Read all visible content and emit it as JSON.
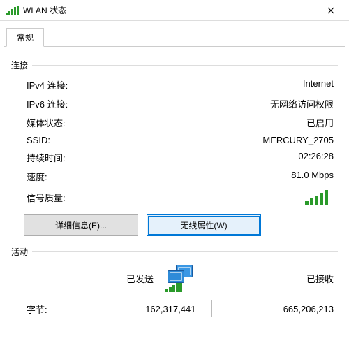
{
  "window": {
    "title": "WLAN 状态"
  },
  "tabs": {
    "general": "常规"
  },
  "connection": {
    "group_label": "连接",
    "ipv4_label": "IPv4 连接:",
    "ipv4_value": "Internet",
    "ipv6_label": "IPv6 连接:",
    "ipv6_value": "无网络访问权限",
    "media_label": "媒体状态:",
    "media_value": "已启用",
    "ssid_label": "SSID:",
    "ssid_value": "MERCURY_2705",
    "duration_label": "持续时间:",
    "duration_value": "02:26:28",
    "speed_label": "速度:",
    "speed_value": "81.0 Mbps",
    "signal_label": "信号质量:"
  },
  "buttons": {
    "details": "详细信息(E)...",
    "wireless_props": "无线属性(W)"
  },
  "activity": {
    "group_label": "活动",
    "sent_label": "已发送",
    "received_label": "已接收",
    "bytes_label": "字节:",
    "bytes_sent": "162,317,441",
    "bytes_received": "665,206,213"
  }
}
